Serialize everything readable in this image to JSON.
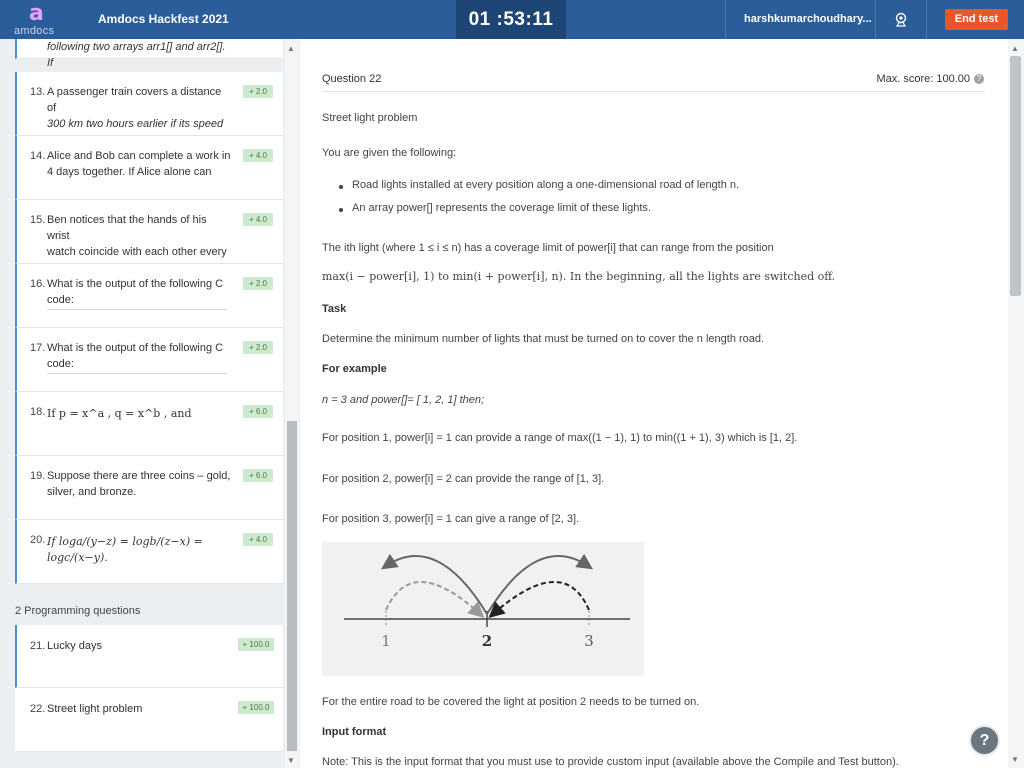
{
  "app": {
    "logo_mark": "a",
    "logo_text": "amdocs",
    "title": "Amdocs Hackfest 2021"
  },
  "header": {
    "timer": "01 :53:11",
    "user": "harshkumarchoudhary...",
    "end_button": "End test",
    "camera_icon": "webcam-icon"
  },
  "sidebar": {
    "partial_text": "following two arrays arr1[] and arr2[]. If",
    "questions": [
      {
        "num": "13.",
        "line1": "A passenger train covers a distance of",
        "line2": "300 km two hours earlier if its speed",
        "score": "+ 2.0"
      },
      {
        "num": "14.",
        "line1": "Alice and Bob can complete a work in",
        "line2": "4 days together. If Alice alone can",
        "score": "+ 4.0"
      },
      {
        "num": "15.",
        "line1": "Ben notices that the hands of his wrist",
        "line2": "watch coincide with each other every",
        "score": "+ 4.0"
      },
      {
        "num": "16.",
        "line1": "What is the output of the following C",
        "line2": "code:",
        "score": "+ 2.0"
      },
      {
        "num": "17.",
        "line1": "What is the output of the following C",
        "line2": "code:",
        "score": "+ 2.0"
      },
      {
        "num": "18.",
        "line1": "If p = x^a , q = x^b , and",
        "line2": "",
        "score": "+ 6.0"
      },
      {
        "num": "19.",
        "line1": "Suppose there are three coins – gold,",
        "line2": "silver, and bronze.",
        "score": "+ 6.0"
      },
      {
        "num": "20.",
        "line1": "If loga/(y−z) = logb/(z−x) = logc/(x−y).",
        "line2": "",
        "score": "+ 4.0"
      }
    ],
    "section_label": "2 Programming questions",
    "programming": [
      {
        "num": "21.",
        "label": "Lucky days",
        "score": "+ 100.0"
      },
      {
        "num": "22.",
        "label": "Street light problem",
        "score": "+ 100.0"
      }
    ]
  },
  "question": {
    "label": "Question  22",
    "max_score": "Max. score: 100.00",
    "title": "Street light problem",
    "intro": "You are given the following:",
    "bullets": [
      "Road lights installed at every position along a one-dimensional road of length n.",
      "An array power[] represents the coverage limit of these lights."
    ],
    "desc1": "The ith light (where 1 ≤ i ≤ n) has a coverage limit of power[i] that can range from the position",
    "desc2": "max(i − power[i], 1) to min(i + power[i], n). In the beginning, all the lights are switched off.",
    "task_heading": "Task",
    "task_text": "Determine the minimum number of lights that must be turned on to cover the n length road.",
    "example_heading": "For example",
    "example_input": "n = 3 and power[]= [ 1, 2, 1] then;",
    "pos1": "For position 1, power[i] = 1 can provide a range of max((1 − 1), 1) to min((1 + 1), 3) which is [1, 2].",
    "pos2": "For position 2, power[i] = 2 can provide the range of [1, 3].",
    "pos3": "For position 3, power[i] = 1 can give a range of [2, 3].",
    "figure_labels": [
      "1",
      "2",
      "3"
    ],
    "conclusion": "For the entire road to be covered the light at position 2 needs to be turned on.",
    "input_heading": "Input format",
    "note": "Note: This is the input format that you must use to provide custom input (available above the Compile and Test button)."
  }
}
